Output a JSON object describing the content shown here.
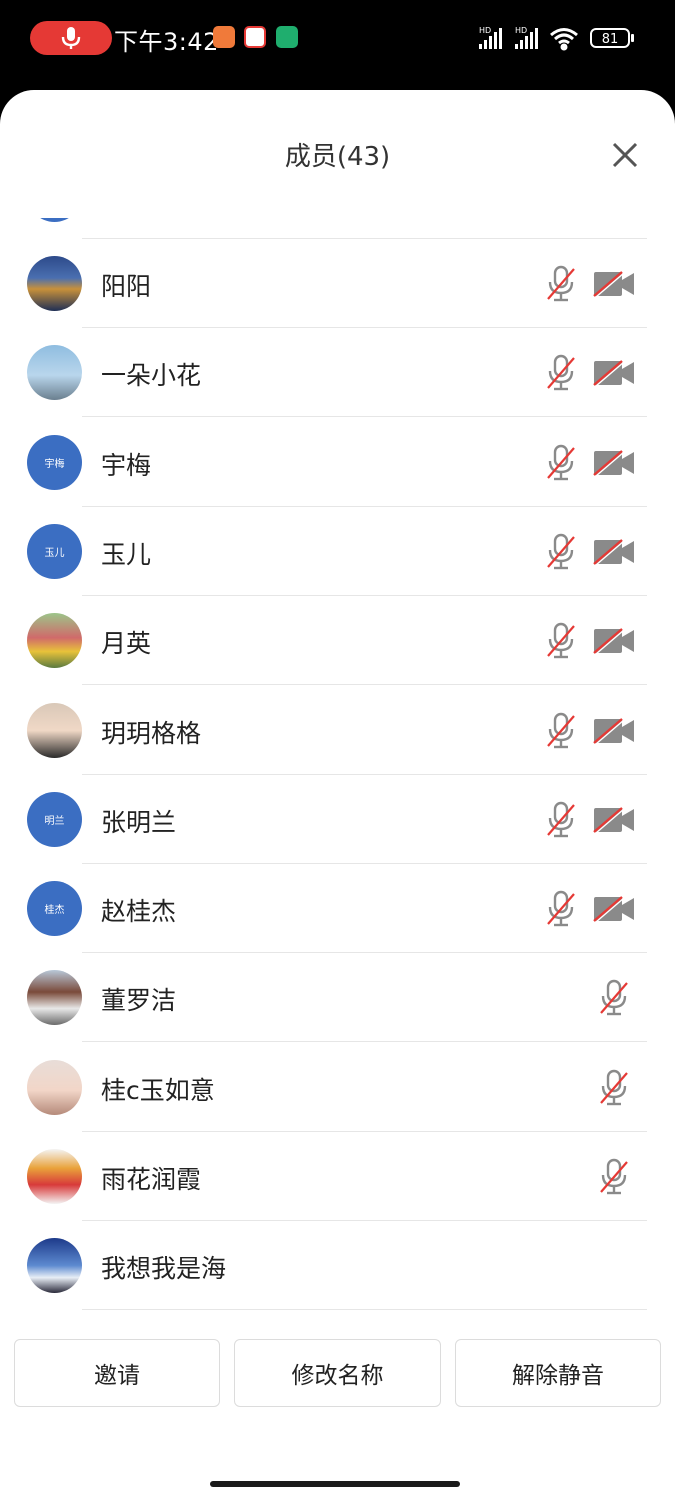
{
  "status_bar": {
    "time": "下午3:42",
    "battery": "81",
    "network_label_1": "HD",
    "network_label_2": "HD",
    "app_icons": [
      "orange-shopping-app-icon",
      "red-map-app-icon",
      "green-shield-app-icon"
    ]
  },
  "header": {
    "title": "成员(43)"
  },
  "colors": {
    "accent_blue": "#3b6ec2",
    "muted_slash": "#e53935",
    "icon_gray": "#888888",
    "rec_red": "#e53935"
  },
  "members": [
    {
      "name": "阳阳",
      "avatar_type": "photo-night-city",
      "avatar_text": "",
      "mic": "muted",
      "camera": "off"
    },
    {
      "name": "一朵小花",
      "avatar_type": "photo-tower",
      "avatar_text": "",
      "mic": "muted",
      "camera": "off"
    },
    {
      "name": "宇梅",
      "avatar_type": "initials",
      "avatar_text": "宇梅",
      "mic": "muted",
      "camera": "off"
    },
    {
      "name": "玉儿",
      "avatar_type": "initials",
      "avatar_text": "玉儿",
      "mic": "muted",
      "camera": "off"
    },
    {
      "name": "月英",
      "avatar_type": "photo-garden",
      "avatar_text": "",
      "mic": "muted",
      "camera": "off"
    },
    {
      "name": "玥玥格格",
      "avatar_type": "photo-portrait",
      "avatar_text": "",
      "mic": "muted",
      "camera": "off"
    },
    {
      "name": "张明兰",
      "avatar_type": "initials",
      "avatar_text": "明兰",
      "mic": "muted",
      "camera": "off"
    },
    {
      "name": "赵桂杰",
      "avatar_type": "initials",
      "avatar_text": "桂杰",
      "mic": "muted",
      "camera": "off"
    },
    {
      "name": "董罗洁",
      "avatar_type": "photo-building",
      "avatar_text": "",
      "mic": "muted",
      "camera": "none"
    },
    {
      "name": "桂c玉如意",
      "avatar_type": "photo-portrait-2",
      "avatar_text": "",
      "mic": "muted",
      "camera": "none"
    },
    {
      "name": "雨花润霞",
      "avatar_type": "photo-cartoon",
      "avatar_text": "",
      "mic": "muted",
      "camera": "none"
    },
    {
      "name": "我想我是海",
      "avatar_type": "photo-sky",
      "avatar_text": "",
      "mic": "none",
      "camera": "none"
    }
  ],
  "footer": {
    "invite_label": "邀请",
    "rename_label": "修改名称",
    "unmute_label": "解除静音"
  }
}
